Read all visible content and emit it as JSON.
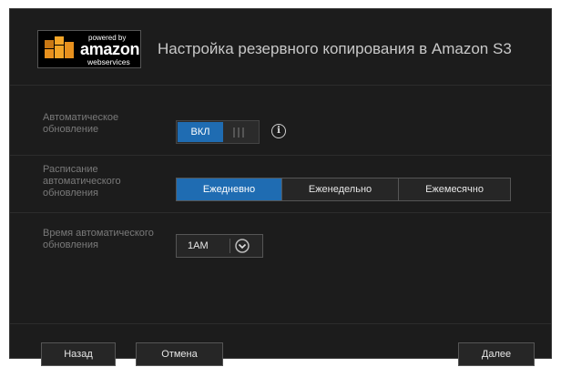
{
  "header": {
    "logo_powered": "powered by",
    "logo_brand": "amazon",
    "logo_sub": "webservices",
    "title": "Настройка резервного копирования в Amazon S3"
  },
  "auto_update": {
    "label": "Автоматическое обновление",
    "toggle_label": "ВКЛ",
    "state": "on"
  },
  "schedule": {
    "label": "Расписание автоматического обновления",
    "options": [
      "Ежедневно",
      "Еженедельно",
      "Ежемесячно"
    ],
    "selected": "Ежедневно"
  },
  "time": {
    "label": "Время автоматического обновления",
    "value": "1AM"
  },
  "footer": {
    "back": "Назад",
    "cancel": "Отмена",
    "next": "Далее"
  },
  "colors": {
    "accent": "#1f6cb2",
    "background": "#1c1c1c"
  }
}
